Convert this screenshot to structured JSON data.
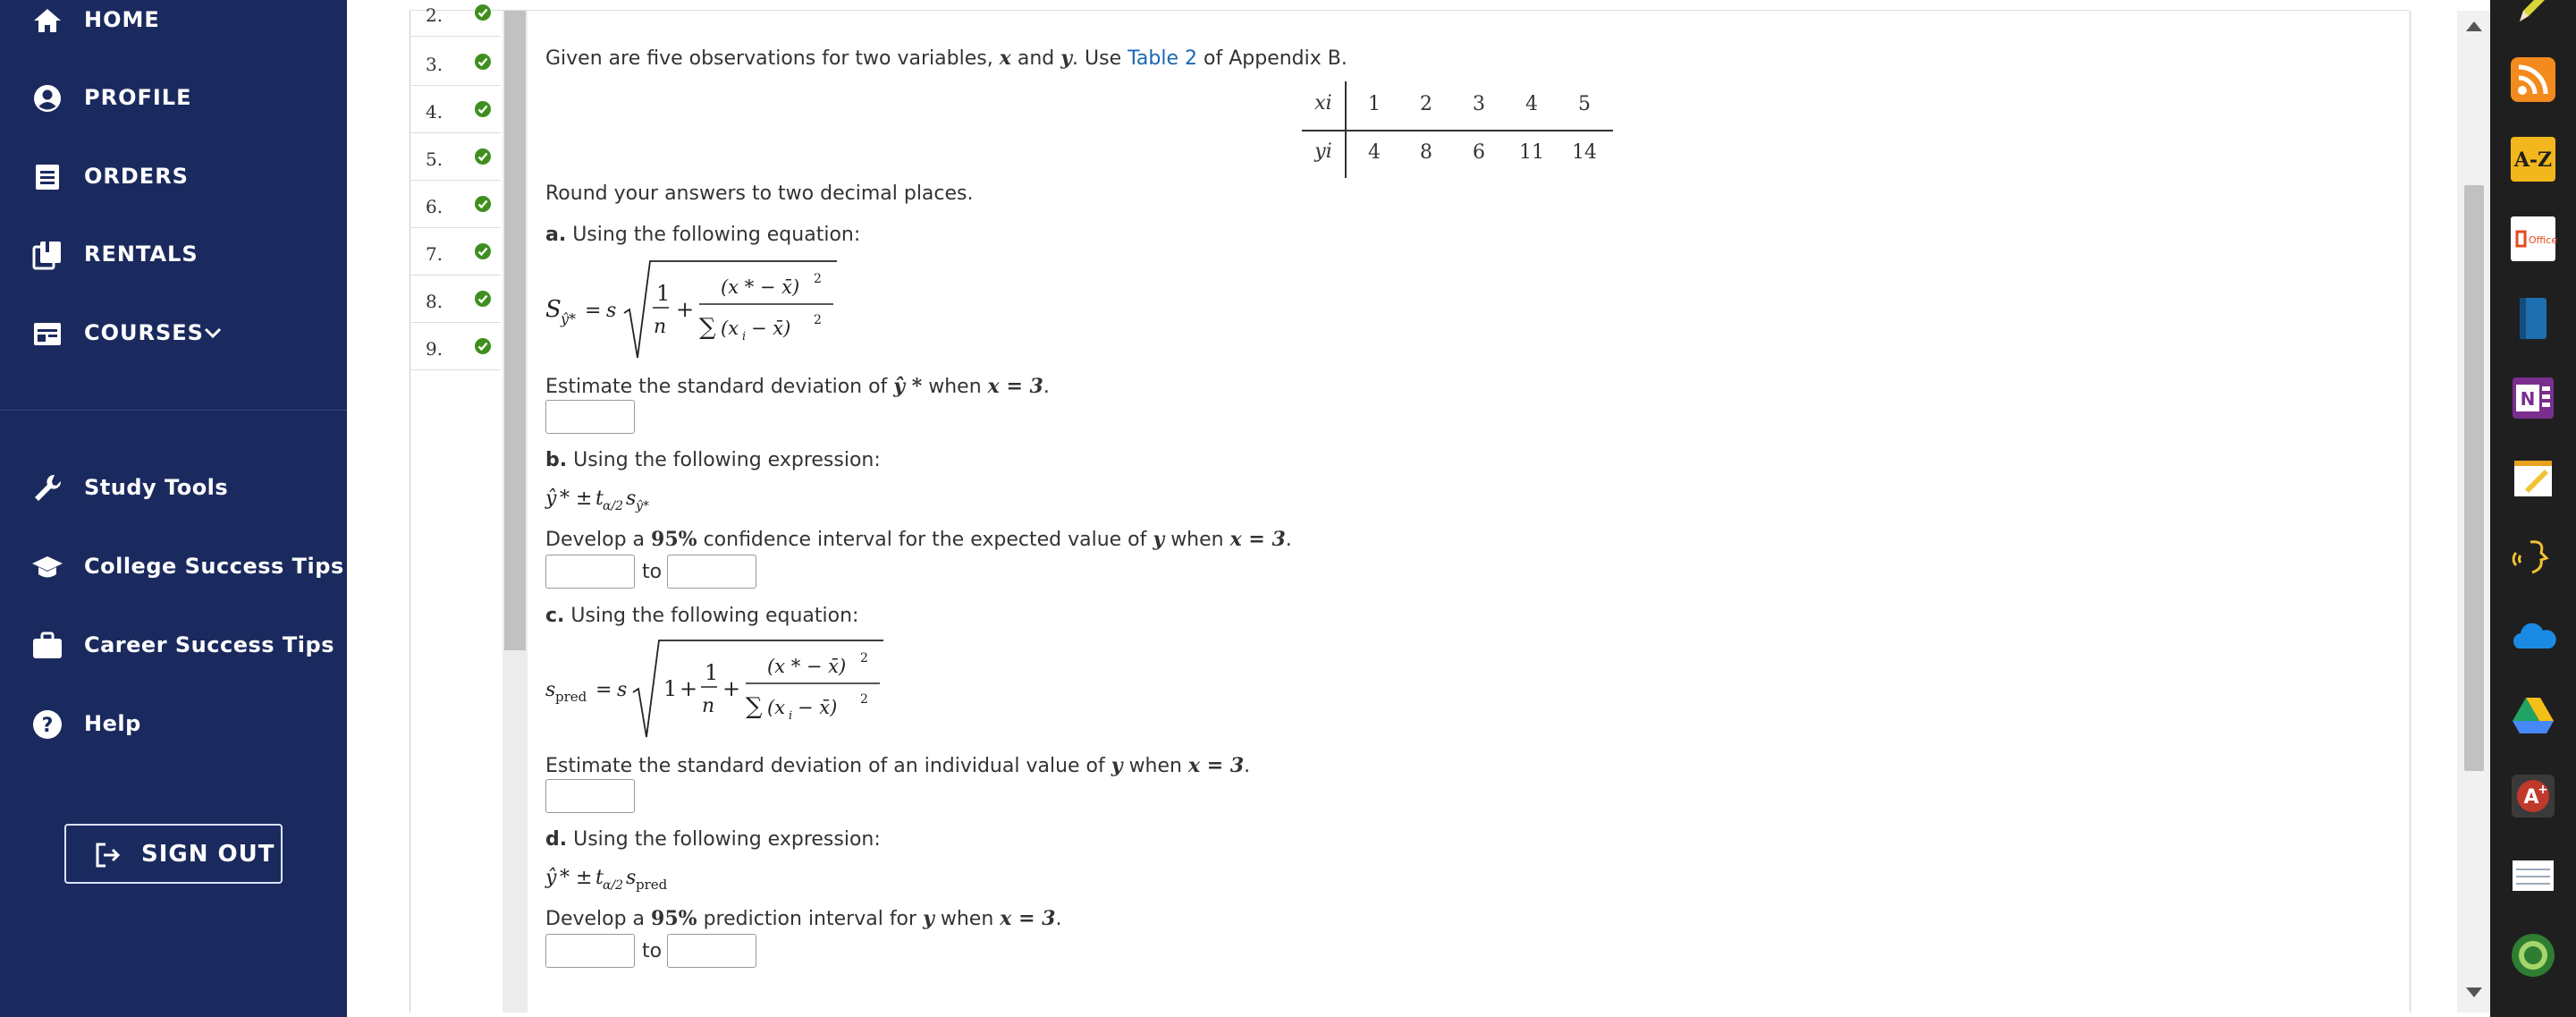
{
  "sidebar": {
    "items": [
      {
        "label": "HOME",
        "icon": "home-icon"
      },
      {
        "label": "PROFILE",
        "icon": "user-circle-icon"
      },
      {
        "label": "ORDERS",
        "icon": "orders-list-icon"
      },
      {
        "label": "RENTALS",
        "icon": "rentals-books-icon"
      },
      {
        "label": "COURSES",
        "icon": "courses-card-icon"
      },
      {
        "label": "Study Tools",
        "icon": "wrench-icon"
      },
      {
        "label": "College Success Tips",
        "icon": "graduation-cap-icon"
      },
      {
        "label": "Career Success Tips",
        "icon": "briefcase-icon"
      },
      {
        "label": "Help",
        "icon": "help-circle-icon"
      }
    ],
    "signout_label": "SIGN OUT"
  },
  "question_list": [
    "2.",
    "3.",
    "4.",
    "5.",
    "6.",
    "7.",
    "8.",
    "9."
  ],
  "question": {
    "intro_text": "Given are five observations for two variables,",
    "var_x": "x",
    "and_text": "and",
    "var_y": "y",
    "use_text": ". Use",
    "table_link": "Table 2",
    "appendix_text": "of Appendix B.",
    "table": {
      "x_label": "xi",
      "y_label": "yi",
      "x_values": [
        "1",
        "2",
        "3",
        "4",
        "5"
      ],
      "y_values": [
        "4",
        "8",
        "6",
        "11",
        "14"
      ]
    },
    "round_text": "Round your answers to two decimal places.",
    "part_a": {
      "letter": "a.",
      "label": "Using the following equation:",
      "prompt_start": "Estimate the standard deviation of",
      "prompt_when": "when",
      "condition": "x = 3",
      "period": "."
    },
    "part_b": {
      "letter": "b.",
      "label": "Using the following expression:",
      "prompt_start": "Develop a",
      "percent": "95%",
      "prompt_mid": "confidence interval for the expected value of",
      "var": "y",
      "prompt_when": "when",
      "condition": "x = 3",
      "period": ".",
      "to_text": "to"
    },
    "part_c": {
      "letter": "c.",
      "label": "Using the following equation:",
      "prompt_start": "Estimate the standard deviation of an individual value of",
      "var": "y",
      "prompt_when": "when",
      "condition": "x = 3",
      "period": "."
    },
    "part_d": {
      "letter": "d.",
      "label": "Using the following expression:",
      "prompt_start": "Develop a",
      "percent": "95%",
      "prompt_mid": "prediction interval for",
      "var": "y",
      "prompt_when": "when",
      "condition": "x = 3",
      "period": ".",
      "to_text": "to"
    }
  },
  "dock": [
    "pencil-icon",
    "rss-icon",
    "a-z-icon",
    "office-icon",
    "book-icon",
    "onenote-icon",
    "notepad-icon",
    "speech-icon",
    "onedrive-icon",
    "google-drive-icon",
    "a-plus-icon",
    "notes-icon",
    "green-circle-icon"
  ],
  "colors": {
    "sidebar_bg": "#1b2a5e",
    "link": "#1a67b3",
    "check_green": "#3f8f1f",
    "dock_bg": "#1f1f1f"
  }
}
